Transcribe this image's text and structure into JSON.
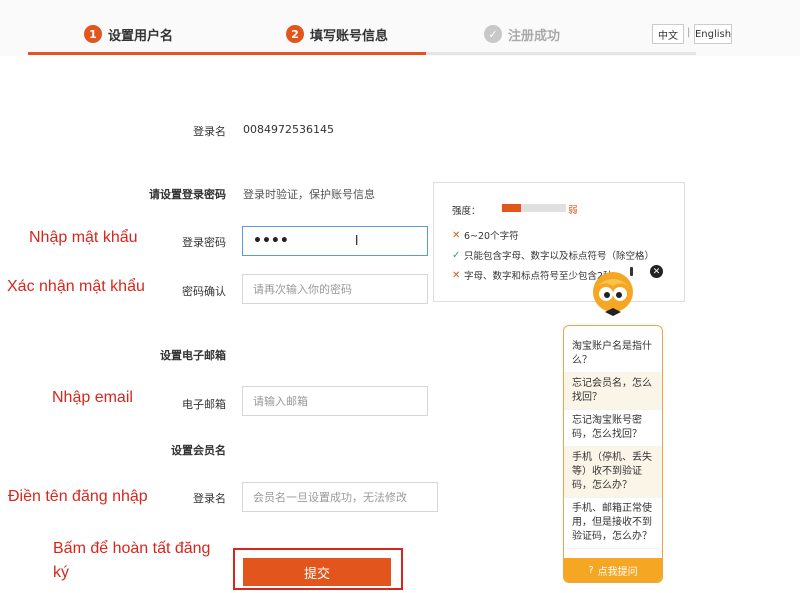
{
  "header": {
    "steps": [
      {
        "num": "1",
        "label": "设置用户名"
      },
      {
        "num": "2",
        "label": "填写账号信息"
      },
      {
        "num": "",
        "label": "注册成功"
      }
    ],
    "lang_zh": "中文",
    "lang_sep": "|",
    "lang_en": "English"
  },
  "form": {
    "login_label": "登录名",
    "login_value": "0084972536145",
    "password_group": "请设置登录密码",
    "password_hint": "登录时验证，保护账号信息",
    "password_label": "登录密码",
    "password_value": "••••",
    "confirm_label": "密码确认",
    "confirm_placeholder": "请再次输入你的密码",
    "email_group": "设置电子邮箱",
    "email_label": "电子邮箱",
    "email_placeholder": "请输入邮箱",
    "member_group": "设置会员名",
    "member_label": "登录名",
    "member_placeholder": "会员名一旦设置成功，无法修改",
    "submit_label": "提交"
  },
  "strength": {
    "label": "强度：",
    "level": "弱",
    "level_fraction": 0.3,
    "rules": [
      {
        "status": "fail",
        "text": "6~20个字符"
      },
      {
        "status": "pass",
        "text": "只能包含字母、数字以及标点符号（除空格）"
      },
      {
        "status": "fail",
        "text": "字母、数字和标点符号至少包含2种"
      }
    ]
  },
  "help": {
    "items": [
      "淘宝账户名是指什么？",
      "忘记会员名，怎么找回？",
      "忘记淘宝账号密码，怎么找回？",
      "手机（停机、丢失等）收不到验证码，怎么办？",
      "手机、邮箱正常使用，但是接收不到验证码，怎么办？"
    ],
    "footer": "点我提问"
  },
  "annotations": {
    "password": "Nhập mật khẩu",
    "confirm": "Xác nhận mật khẩu",
    "email": "Nhập email",
    "username": "Điền tên đăng nhập",
    "submit": "Bấm để hoàn tất đăng ký"
  },
  "colors": {
    "accent": "#e2561e",
    "annotation": "#d9261c",
    "valid": "#2a9d8f"
  }
}
